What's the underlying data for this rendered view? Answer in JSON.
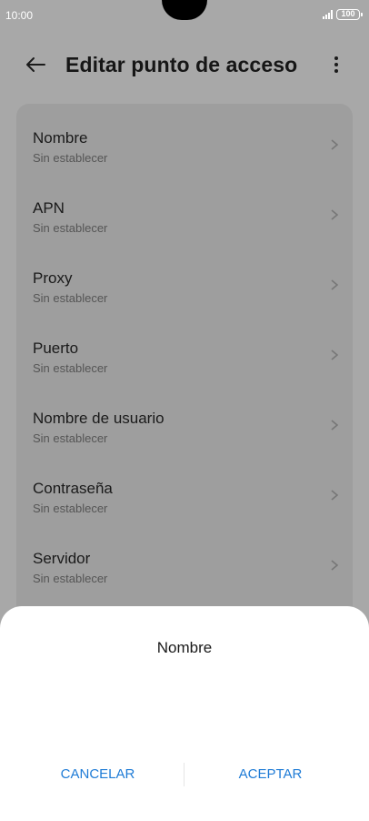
{
  "status_bar": {
    "time": "10:00",
    "battery": "100"
  },
  "header": {
    "title": "Editar punto de acceso",
    "back_icon": "arrow-left-icon",
    "more_icon": "more-vertical-icon"
  },
  "list": {
    "items": [
      {
        "title": "Nombre",
        "subtitle": "Sin establecer"
      },
      {
        "title": "APN",
        "subtitle": "Sin establecer"
      },
      {
        "title": "Proxy",
        "subtitle": "Sin establecer"
      },
      {
        "title": "Puerto",
        "subtitle": "Sin establecer"
      },
      {
        "title": "Nombre de usuario",
        "subtitle": "Sin establecer"
      },
      {
        "title": "Contraseña",
        "subtitle": "Sin establecer"
      },
      {
        "title": "Servidor",
        "subtitle": "Sin establecer"
      }
    ]
  },
  "dialog": {
    "title": "Nombre",
    "cancel_label": "CANCELAR",
    "accept_label": "ACEPTAR"
  },
  "colors": {
    "accent": "#1e7bd6",
    "scrim": "#a8a8a8"
  }
}
